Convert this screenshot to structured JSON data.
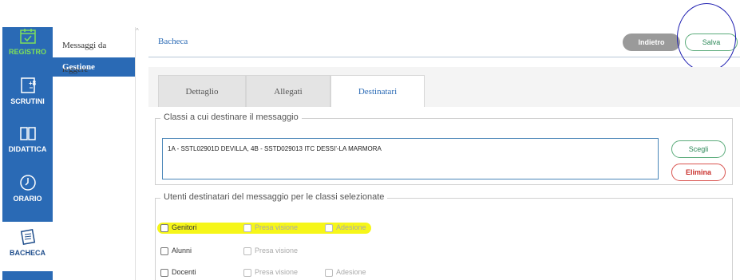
{
  "rail": {
    "items": [
      {
        "label": "REGISTRO",
        "icon": "calendar-check-icon"
      },
      {
        "label": "SCRUTINI",
        "icon": "grade-sheet-icon"
      },
      {
        "label": "DIDATTICA",
        "icon": "book-icon"
      },
      {
        "label": "ORARIO",
        "icon": "clock-icon"
      },
      {
        "label": "BACHECA",
        "icon": "noticeboard-icon"
      }
    ]
  },
  "subnav": {
    "items": [
      {
        "label": "Messaggi da leggere"
      },
      {
        "label": "Gestione Bacheca"
      }
    ]
  },
  "header": {
    "title": "Bacheca",
    "back_label": "Indietro",
    "save_label": "Salva"
  },
  "tabs": [
    {
      "label": "Dettaglio"
    },
    {
      "label": "Allegati"
    },
    {
      "label": "Destinatari"
    }
  ],
  "classes_section": {
    "legend": "Classi a cui destinare il messaggio",
    "value": "1A - SSTL02901D DEVILLA, 4B - SSTD029013  ITC DESSI'-LA MARMORA",
    "choose_label": "Scegli",
    "delete_label": "Elimina"
  },
  "users_section": {
    "legend": "Utenti destinatari del messaggio per le classi selezionate",
    "rows": [
      {
        "label": "Genitori",
        "presa_visione": "Presa visione",
        "adesione": "Adesione"
      },
      {
        "label": "Alunni",
        "presa_visione": "Presa visione",
        "adesione": ""
      },
      {
        "label": "Docenti",
        "presa_visione": "Presa visione",
        "adesione": "Adesione"
      }
    ]
  },
  "colors": {
    "primary": "#2a6ab5",
    "registro_active": "#7ee05a",
    "success": "#5aab7a",
    "danger": "#d9534f",
    "highlight": "#f5f500"
  }
}
